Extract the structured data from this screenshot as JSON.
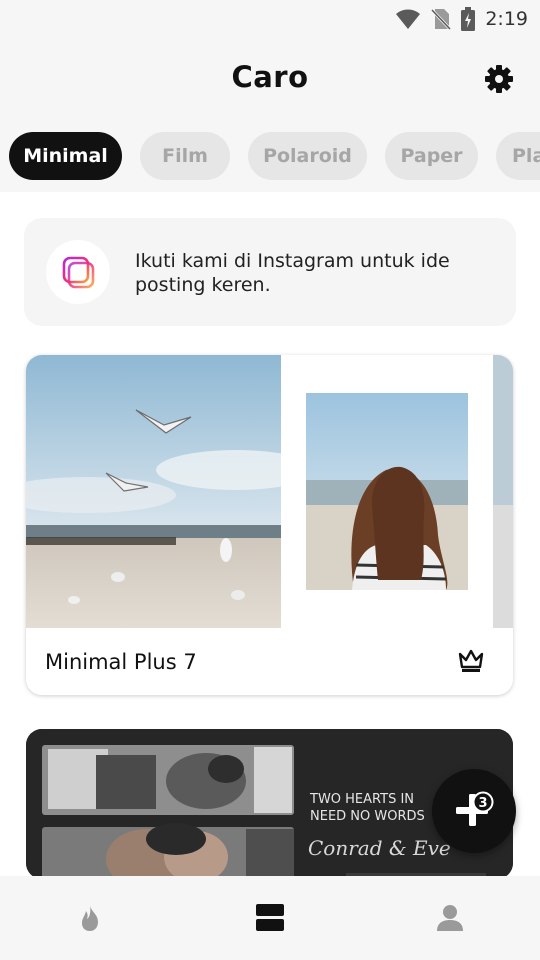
{
  "status": {
    "time": "2:19"
  },
  "header": {
    "title": "Caro"
  },
  "tabs": [
    {
      "label": "Minimal",
      "active": true
    },
    {
      "label": "Film",
      "active": false
    },
    {
      "label": "Polaroid",
      "active": false
    },
    {
      "label": "Paper",
      "active": false
    },
    {
      "label": "Pla",
      "active": false
    }
  ],
  "promo": {
    "text": "Ikuti kami di Instagram untuk ide posting keren."
  },
  "templates": [
    {
      "title": "Minimal Plus 7",
      "premium": true
    },
    {
      "title": "",
      "premium": false,
      "image_text": {
        "line1": "TWO HEARTS IN",
        "line2": "NEED NO WORDS",
        "script": "Conrad & Eve"
      }
    }
  ],
  "fab": {
    "badge": "3"
  },
  "bottom_nav": {
    "items": [
      "flame-icon",
      "templates-icon",
      "profile-icon"
    ],
    "active": "templates-icon"
  },
  "colors": {
    "accent": "#111111",
    "background": "#f6f6f6",
    "tab_inactive": "#e6e6e6",
    "nav_active": "#111111",
    "nav_inactive": "#9a9a9a"
  }
}
